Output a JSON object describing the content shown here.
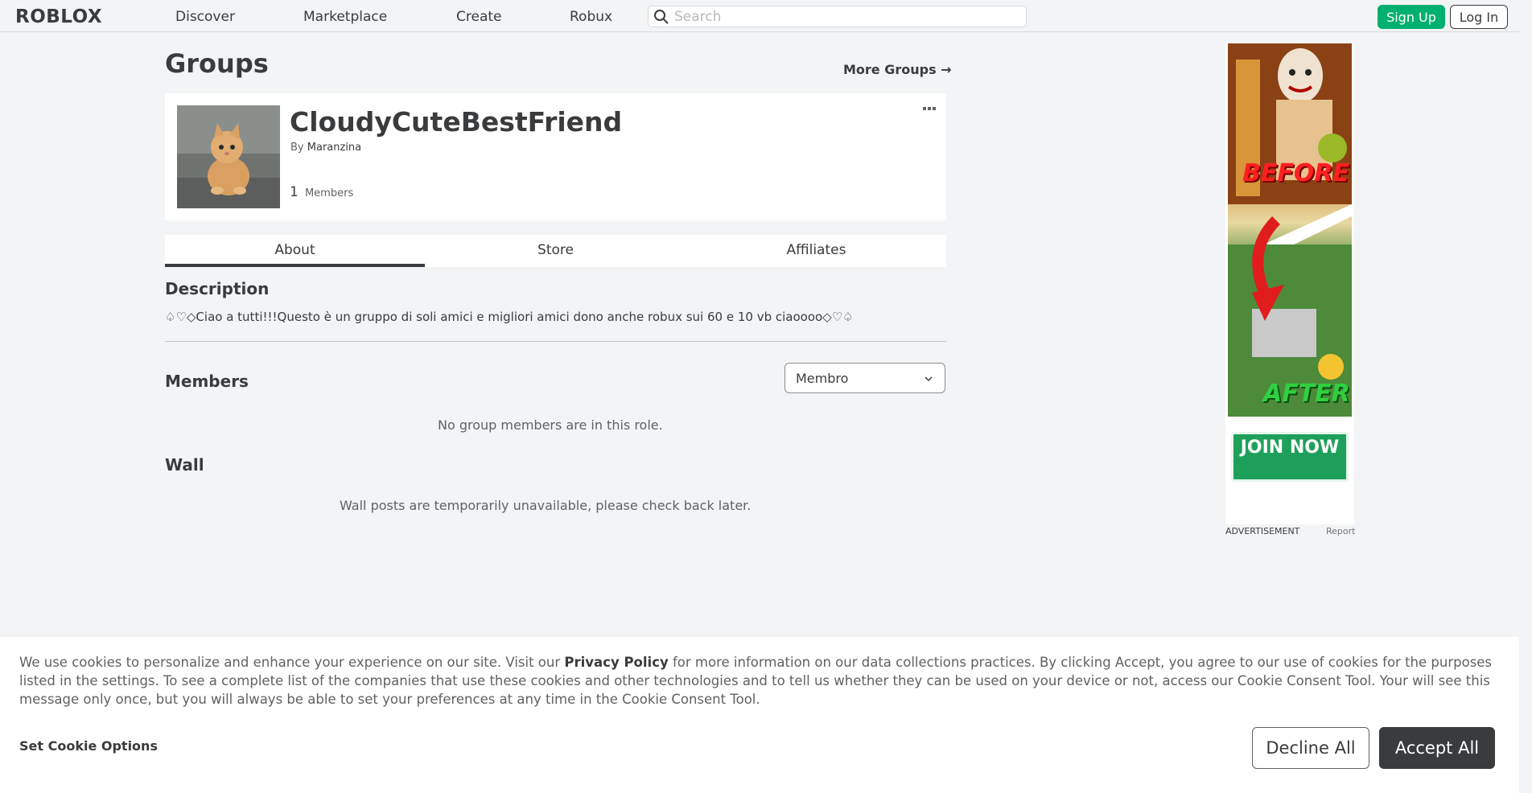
{
  "header": {
    "logo": "ROBLOX",
    "nav": [
      "Discover",
      "Marketplace",
      "Create",
      "Robux"
    ],
    "search_placeholder": "Search",
    "signup_label": "Sign Up",
    "login_label": "Log In"
  },
  "page": {
    "title": "Groups",
    "more_groups": "More Groups →"
  },
  "group": {
    "name": "CloudyCuteBestFriend",
    "by_label": "By",
    "owner": "Maranzina",
    "member_count": "1",
    "members_label": "Members"
  },
  "tabs": [
    "About",
    "Store",
    "Affiliates"
  ],
  "about": {
    "description_title": "Description",
    "description_text": "♤♡◇Ciao a tutti!!!Questo è un gruppo di soli amici e migliori amici dono anche robux sui 60 e 10 vb ciaoooo◇♡♤",
    "members_title": "Members",
    "role_selected": "Membro",
    "no_members_text": "No group members are in this role.",
    "wall_title": "Wall",
    "wall_text": "Wall posts are temporarily unavailable, please check back later."
  },
  "ad": {
    "before_text": "BEFORE",
    "after_text": "AFTER",
    "join_text": "JOIN NOW",
    "label": "ADVERTISEMENT",
    "report": "Report"
  },
  "cookie": {
    "text_1": "We use cookies to personalize and enhance your experience on our site. Visit our ",
    "privacy_link": "Privacy Policy",
    "text_2": " for more information on our data collections practices. By clicking Accept, you agree to our use of cookies for the purposes listed in the settings. To see a complete list of the companies that use these cookies and other technologies and to tell us whether they can be used on your device or not, access our Cookie Consent Tool. Your will see this message only once, but you will always be able to set your preferences at any time in the Cookie Consent Tool.",
    "options_label": "Set Cookie Options",
    "decline_label": "Decline All",
    "accept_label": "Accept All"
  },
  "colors": {
    "accent_green": "#00b06f",
    "text_dark": "#393b3d",
    "background": "#f2f4f5"
  }
}
